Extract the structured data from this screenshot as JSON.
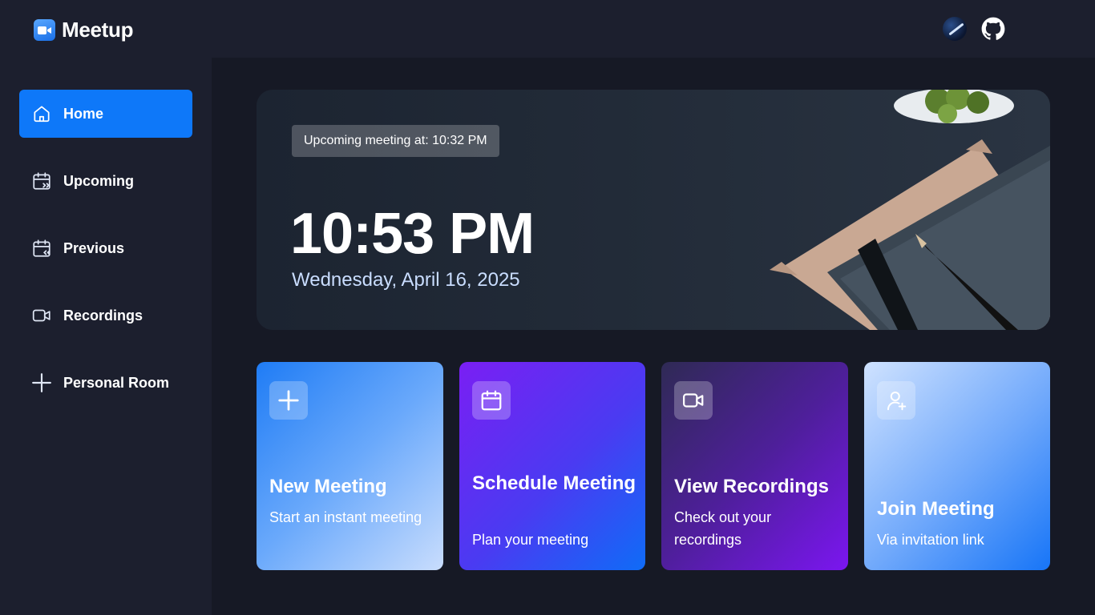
{
  "app": {
    "name": "Meetup"
  },
  "header": {
    "avatar_icon": "user-avatar",
    "github_icon": "github-icon"
  },
  "sidebar": {
    "items": [
      {
        "label": "Home",
        "icon": "home-icon",
        "active": true
      },
      {
        "label": "Upcoming",
        "icon": "calendar-forward-icon",
        "active": false
      },
      {
        "label": "Previous",
        "icon": "calendar-back-icon",
        "active": false
      },
      {
        "label": "Recordings",
        "icon": "video-icon",
        "active": false
      },
      {
        "label": "Personal Room",
        "icon": "plus-icon",
        "active": false
      }
    ]
  },
  "hero": {
    "badge": "Upcoming meeting at: 10:32 PM",
    "time": "10:53 PM",
    "date": "Wednesday, April 16, 2025"
  },
  "cards": [
    {
      "title": "New Meeting",
      "subtitle": "Start an instant meeting",
      "icon": "plus-icon"
    },
    {
      "title": "Schedule Meeting",
      "subtitle": "Plan your meeting",
      "icon": "calendar-icon"
    },
    {
      "title": "View Recordings",
      "subtitle": "Check out your recordings",
      "icon": "video-icon"
    },
    {
      "title": "Join Meeting",
      "subtitle": "Via invitation link",
      "icon": "user-add-icon"
    }
  ],
  "colors": {
    "accent": "#0e78f9",
    "background": "#1c1f2e",
    "main_background": "#161925"
  }
}
